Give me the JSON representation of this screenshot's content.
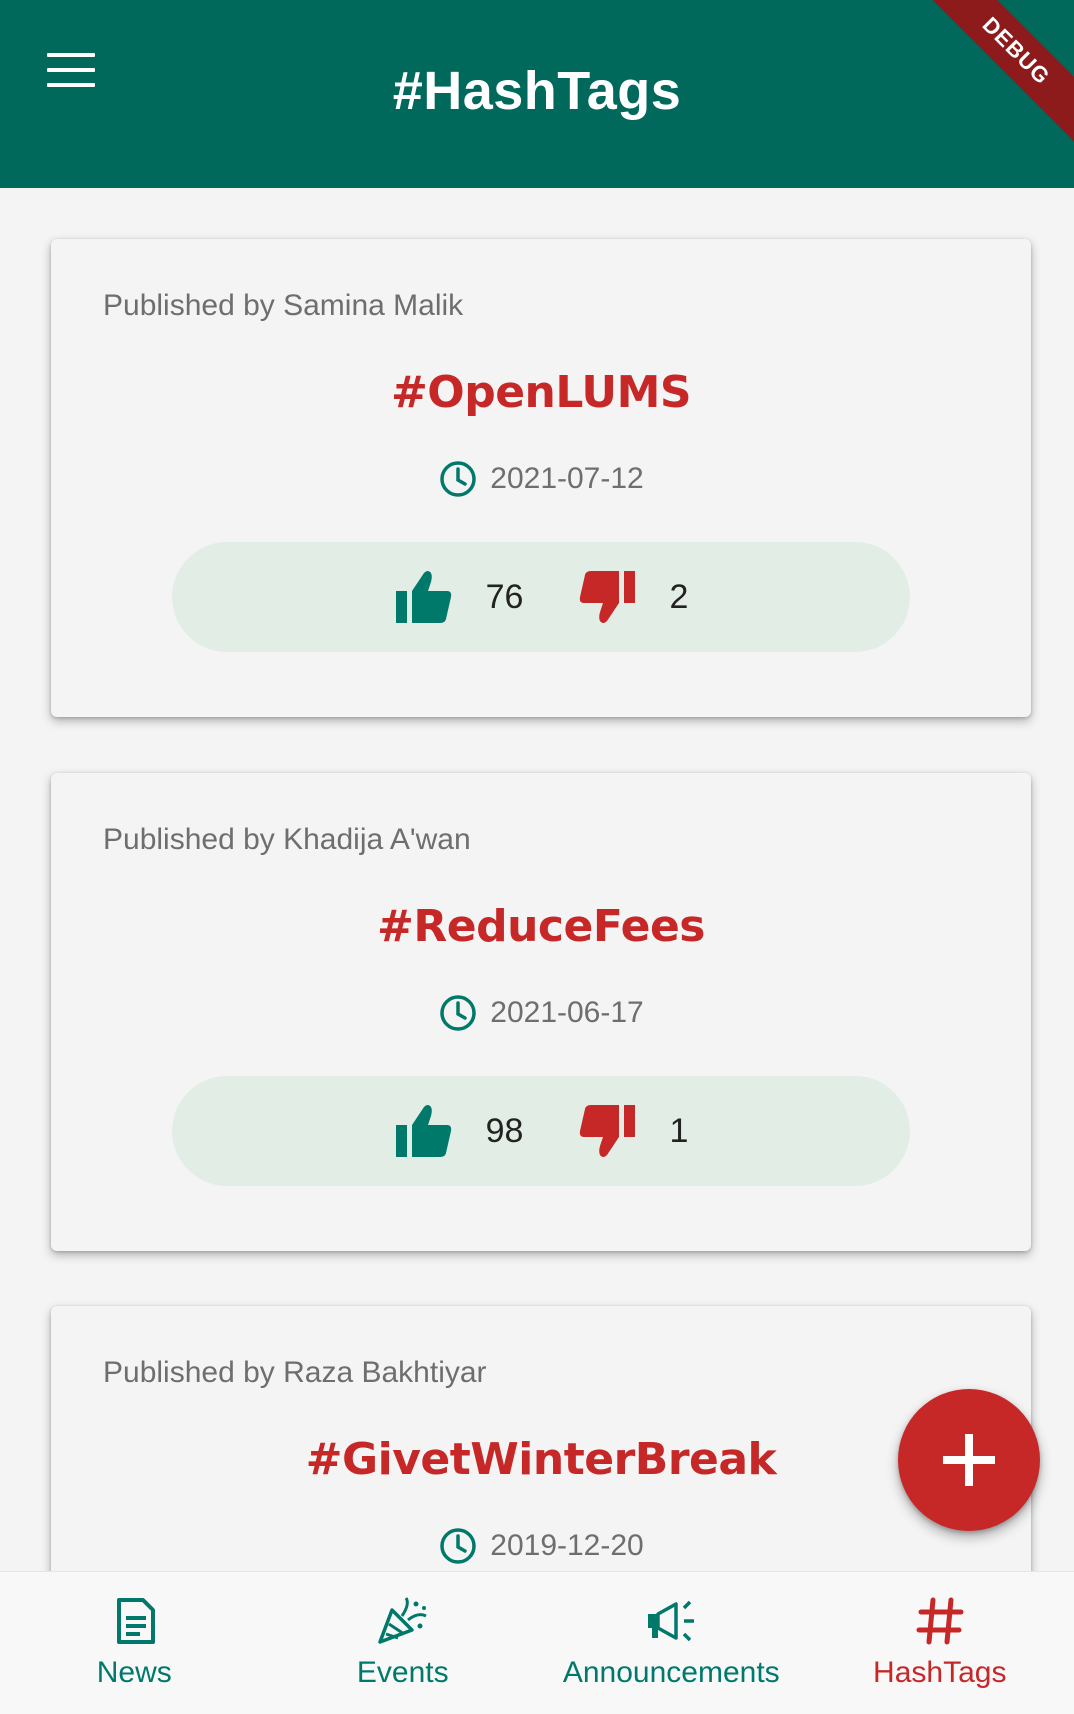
{
  "appbar": {
    "title": "#HashTags",
    "debug_label": "DEBUG",
    "menu_icon": "hamburger-menu-icon"
  },
  "colors": {
    "primary": "#00695c",
    "accent": "#c62828",
    "pill": "#e2eee5"
  },
  "cards": [
    {
      "publisher": "Published by Samina Malik",
      "hashtag": "#OpenLUMS",
      "date": "2021-07-12",
      "likes": "76",
      "dislikes": "2"
    },
    {
      "publisher": "Published by Khadija A'wan",
      "hashtag": "#ReduceFees",
      "date": "2021-06-17",
      "likes": "98",
      "dislikes": "1"
    },
    {
      "publisher": "Published by Raza Bakhtiyar",
      "hashtag": "#GivetWinterBreak",
      "date": "2019-12-20",
      "likes": "",
      "dislikes": ""
    }
  ],
  "fab": {
    "icon": "plus-icon"
  },
  "bottom_nav": {
    "items": [
      {
        "label": "News",
        "icon": "news-icon"
      },
      {
        "label": "Events",
        "icon": "party-popper-icon"
      },
      {
        "label": "Announcements",
        "icon": "megaphone-icon"
      },
      {
        "label": "HashTags",
        "icon": "hashtag-icon"
      }
    ],
    "selected": "HashTags"
  }
}
